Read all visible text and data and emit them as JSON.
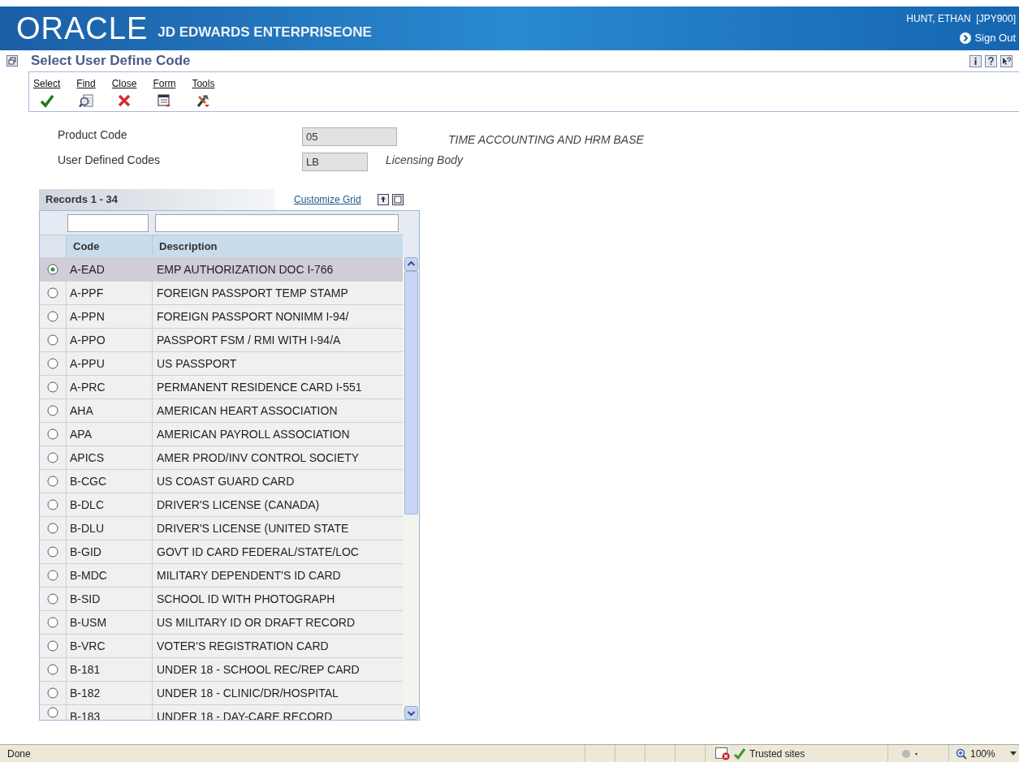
{
  "banner": {
    "logo": "ORACLE",
    "product": "JD EDWARDS ENTERPRISEONE",
    "user": "HUNT, ETHAN  [JPY900]",
    "sign_out": "Sign Out"
  },
  "form": {
    "title": "Select User Define Code"
  },
  "toolbar": [
    {
      "label": "Select",
      "kind": "check"
    },
    {
      "label": "Find",
      "kind": "find"
    },
    {
      "label": "Close",
      "kind": "close"
    },
    {
      "label": "Form",
      "kind": "form"
    },
    {
      "label": "Tools",
      "kind": "tools"
    }
  ],
  "fields": [
    {
      "label": "Product Code",
      "value": "05",
      "description": "TIME ACCOUNTING AND HRM BASE"
    },
    {
      "label": "User Defined Codes",
      "value": "LB",
      "description": "Licensing Body"
    }
  ],
  "grid": {
    "records": "Records 1 - 34",
    "customize": "Customize Grid",
    "columns": [
      "Code",
      "Description"
    ],
    "rows": [
      {
        "code": "A-EAD",
        "description": "EMP AUTHORIZATION DOC I-766",
        "selected": true
      },
      {
        "code": "A-PPF",
        "description": "FOREIGN PASSPORT TEMP STAMP",
        "selected": false
      },
      {
        "code": "A-PPN",
        "description": "FOREIGN PASSPORT  NONIMM I-94/",
        "selected": false
      },
      {
        "code": "A-PPO",
        "description": "PASSPORT FSM / RMI WITH I-94/A",
        "selected": false
      },
      {
        "code": "A-PPU",
        "description": "US PASSPORT",
        "selected": false
      },
      {
        "code": "A-PRC",
        "description": "PERMANENT RESIDENCE CARD I-551",
        "selected": false
      },
      {
        "code": "AHA",
        "description": "AMERICAN HEART ASSOCIATION",
        "selected": false
      },
      {
        "code": "APA",
        "description": "AMERICAN PAYROLL ASSOCIATION",
        "selected": false
      },
      {
        "code": "APICS",
        "description": "AMER PROD/INV CONTROL SOCIETY",
        "selected": false
      },
      {
        "code": "B-CGC",
        "description": "US COAST GUARD CARD",
        "selected": false
      },
      {
        "code": "B-DLC",
        "description": "DRIVER'S LICENSE (CANADA)",
        "selected": false
      },
      {
        "code": "B-DLU",
        "description": "DRIVER'S LICENSE (UNITED STATE",
        "selected": false
      },
      {
        "code": "B-GID",
        "description": "GOVT ID CARD FEDERAL/STATE/LOC",
        "selected": false
      },
      {
        "code": "B-MDC",
        "description": "MILITARY DEPENDENT'S ID CARD",
        "selected": false
      },
      {
        "code": "B-SID",
        "description": "SCHOOL ID WITH PHOTOGRAPH",
        "selected": false
      },
      {
        "code": "B-USM",
        "description": "US MILITARY ID OR DRAFT RECORD",
        "selected": false
      },
      {
        "code": "B-VRC",
        "description": "VOTER'S REGISTRATION CARD",
        "selected": false
      },
      {
        "code": "B-181",
        "description": "UNDER 18 - SCHOOL REC/REP CARD",
        "selected": false
      },
      {
        "code": "B-182",
        "description": "UNDER 18 - CLINIC/DR/HOSPITAL",
        "selected": false
      },
      {
        "code": "B-183",
        "description": "UNDER 18 - DAY-CARE RECORD",
        "selected": false
      }
    ]
  },
  "status_bar": {
    "text": "Done",
    "zone": "Trusted sites",
    "zoom": "100%"
  }
}
